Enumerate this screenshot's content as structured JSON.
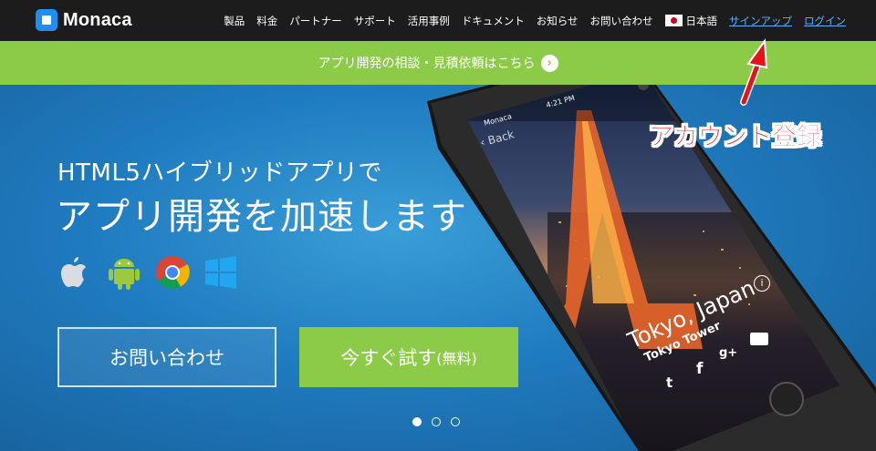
{
  "header": {
    "logo_text": "Monaca",
    "nav": [
      "製品",
      "料金",
      "パートナー",
      "サポート",
      "活用事例",
      "ドキュメント",
      "お知らせ",
      "お問い合わせ"
    ],
    "language": "日本語",
    "signup": "サインアップ",
    "login": "ログイン"
  },
  "banner": {
    "text": "アプリ開発の相談・見積依頼はこちら"
  },
  "hero": {
    "subtitle": "HTML5ハイブリッドアプリで",
    "title": "アプリ開発を加速します",
    "platform_icons": [
      "apple-icon",
      "android-icon",
      "chrome-icon",
      "windows-icon"
    ],
    "contact_button": "お問い合わせ",
    "try_button": "今すぐ試す",
    "try_button_suffix": "(無料)",
    "carousel_dots": 3,
    "carousel_active": 1
  },
  "phone": {
    "carrier": "Monaca",
    "time": "4:21 PM",
    "back_label": "Back",
    "city": "Tokyo, Japan",
    "landmark": "Tokyo Tower"
  },
  "annotation": {
    "text": "アカウント登録"
  },
  "colors": {
    "header_bg": "#1c1c1c",
    "accent_green": "#8ccb47",
    "hero_blue": "#1f7fc0",
    "link_blue": "#5cb0ff",
    "annotation_red": "#e8101a"
  }
}
